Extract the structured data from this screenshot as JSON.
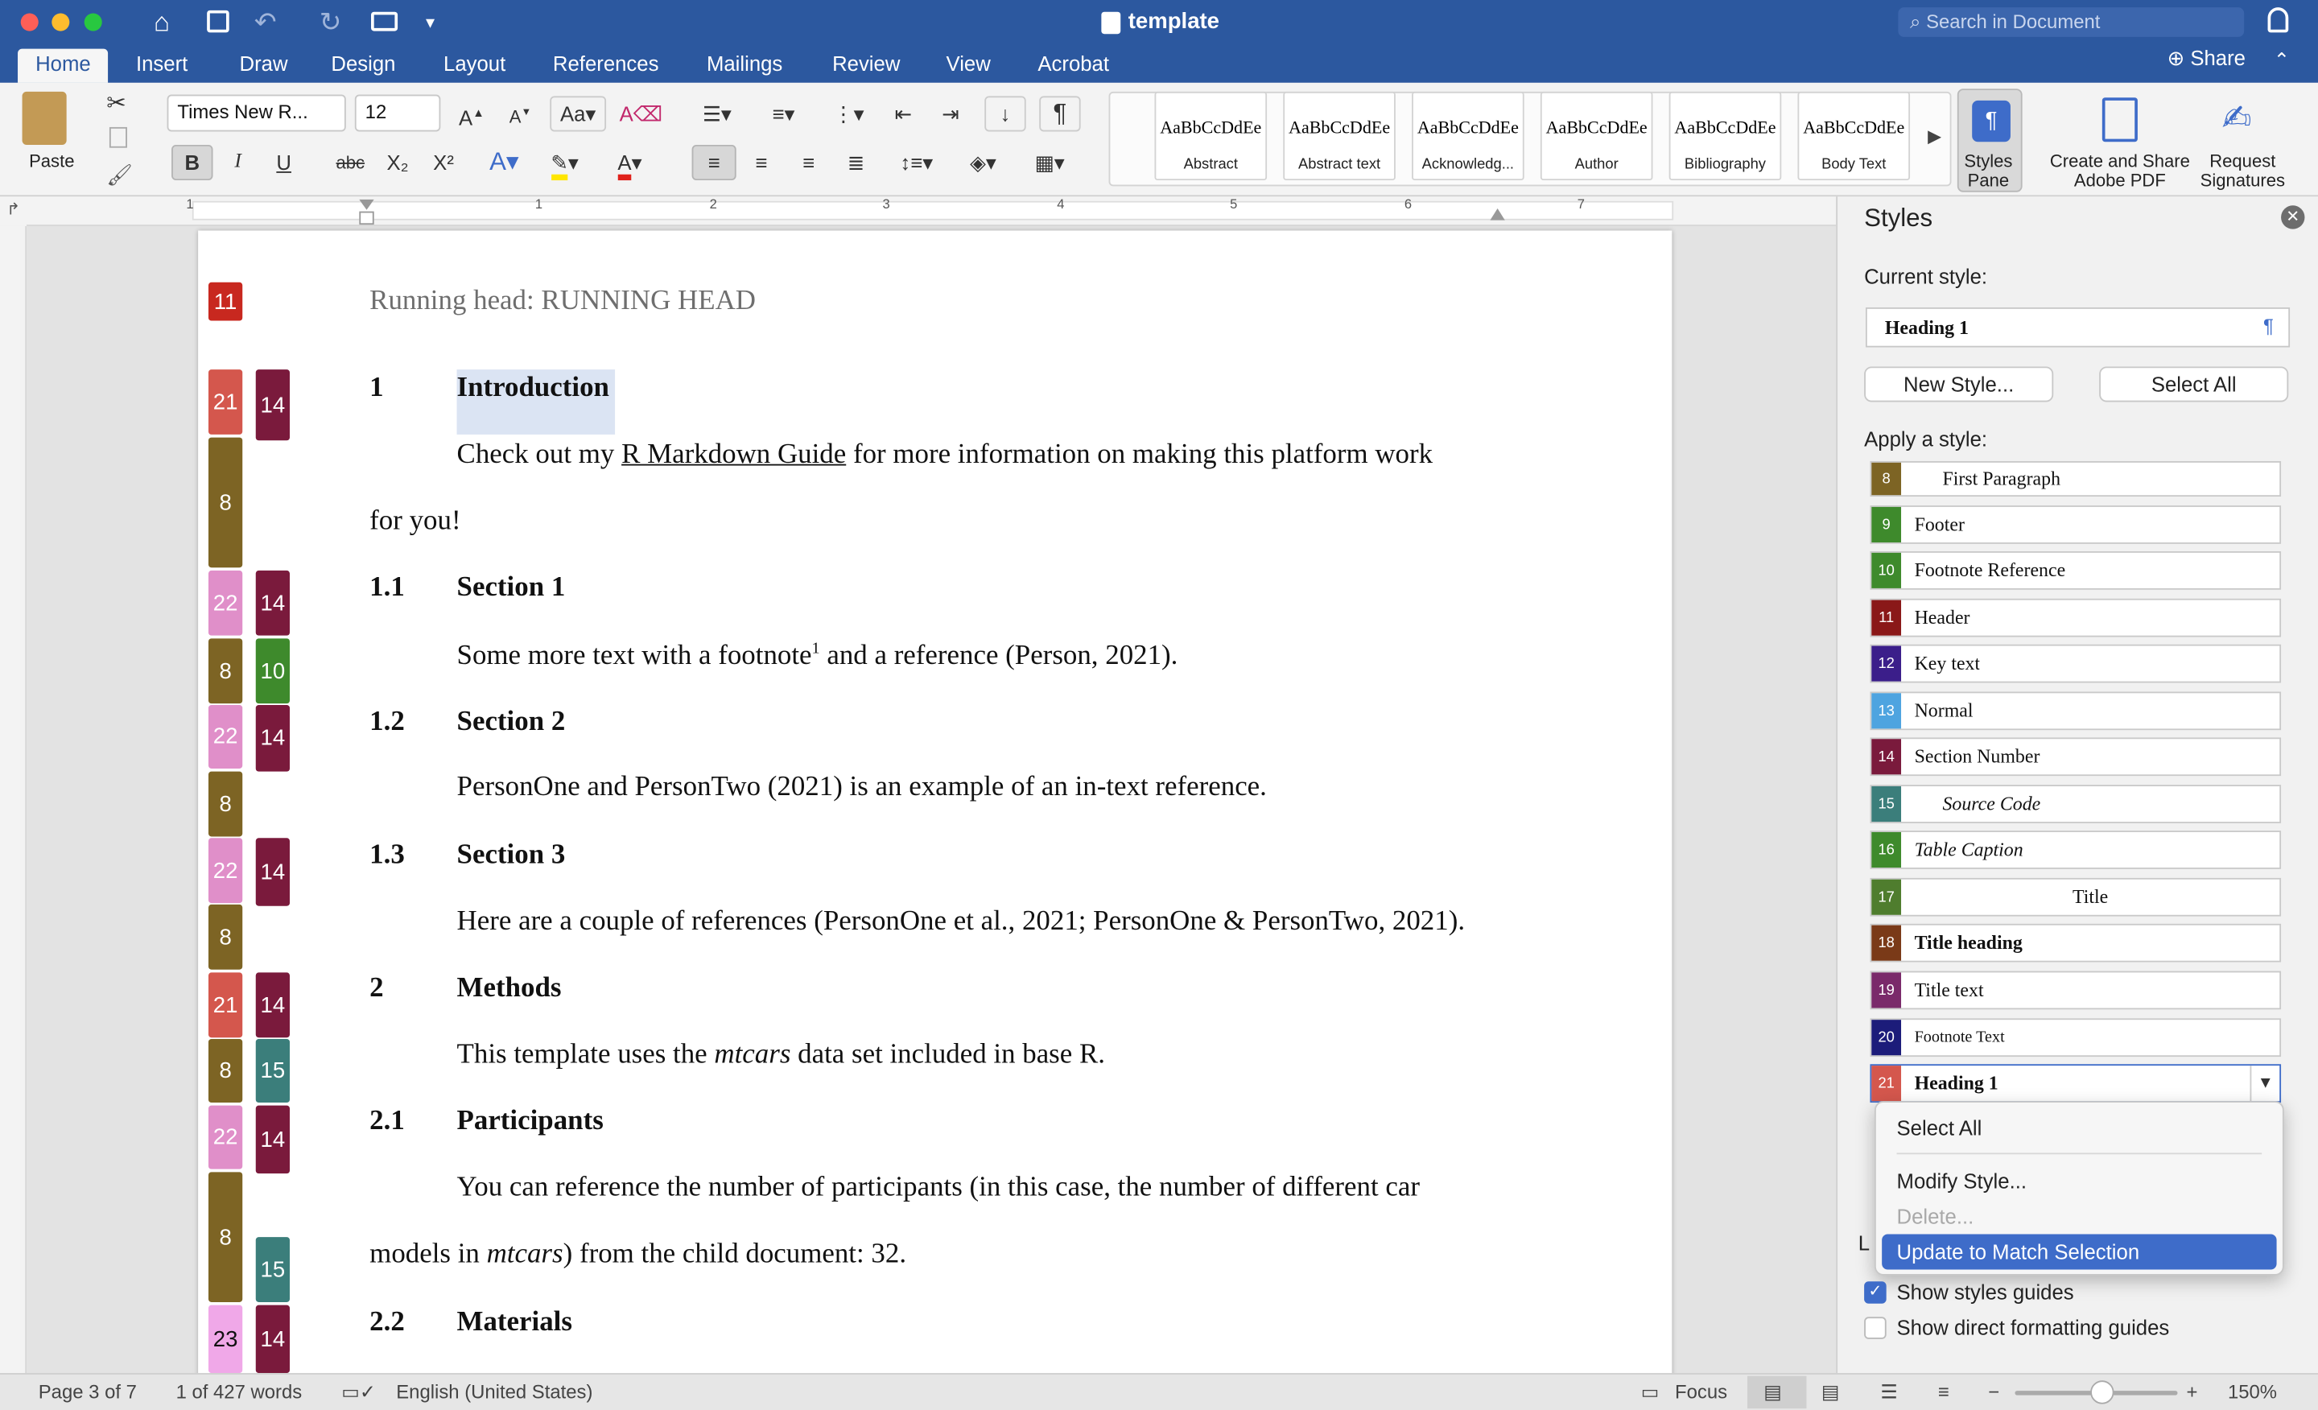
{
  "window": {
    "title": "template",
    "search_placeholder": "Search in Document"
  },
  "tabs": [
    "Home",
    "Insert",
    "Draw",
    "Design",
    "Layout",
    "References",
    "Mailings",
    "Review",
    "View",
    "Acrobat"
  ],
  "share_label": "Share",
  "ribbon": {
    "paste": "Paste",
    "font_name": "Times New R...",
    "font_size": "12",
    "bold": "B",
    "italic": "I",
    "underline": "U",
    "strike": "abc",
    "sub": "X₂",
    "sup": "X²",
    "gallery": [
      {
        "sample": "AaBbCcDdEe",
        "name": "Abstract"
      },
      {
        "sample": "AaBbCcDdEe",
        "name": "Abstract text"
      },
      {
        "sample": "AaBbCcDdEe",
        "name": "Acknowledg..."
      },
      {
        "sample": "AaBbCcDdEe",
        "name": "Author"
      },
      {
        "sample": "AaBbCcDdEe",
        "name": "Bibliography"
      },
      {
        "sample": "AaBbCcDdEe",
        "name": "Body Text"
      }
    ],
    "styles_pane": [
      "Styles",
      "Pane"
    ],
    "create_share": [
      "Create and Share",
      "Adobe PDF"
    ],
    "request_sig": [
      "Request",
      "Signatures"
    ]
  },
  "ruler_numbers": [
    "1",
    "1",
    "2",
    "3",
    "4",
    "5",
    "6",
    "7"
  ],
  "document": {
    "running_head": "Running head: RUNNING HEAD",
    "h1_num": "1",
    "h1": "Introduction",
    "p1a": "Check out my ",
    "p1link": "R Markdown Guide",
    "p1b": " for more information on making this platform work",
    "p1c": "for you!",
    "s11_num": "1.1",
    "s11": "Section 1",
    "p2a": "Some more text with a footnote",
    "p2sup": "1",
    "p2b": " and a reference (Person, 2021).",
    "s12_num": "1.2",
    "s12": "Section 2",
    "p3": "PersonOne and PersonTwo (2021) is an example of an in-text reference.",
    "s13_num": "1.3",
    "s13": "Section 3",
    "p4": "Here are a couple of references (PersonOne et al., 2021; PersonOne & PersonTwo, 2021).",
    "h2_num": "2",
    "h2": "Methods",
    "p5a": "This template uses the ",
    "p5i": "mtcars",
    "p5b": " data set included in base R.",
    "s21_num": "2.1",
    "s21": "Participants",
    "p6": "You can reference the number of participants (in this case, the number of different car",
    "p7a": "models in ",
    "p7i": "mtcars",
    "p7b": ") from the child document: 32.",
    "s22_num": "2.2",
    "s22": "Materials"
  },
  "guides": {
    "col1": [
      "11",
      "21",
      "8",
      "22",
      "8",
      "22",
      "8",
      "22",
      "8",
      "21",
      "8",
      "22",
      "8",
      "23"
    ],
    "col2": [
      "14",
      "14",
      "10",
      "14",
      "14",
      "14",
      "15",
      "14",
      "15",
      "14"
    ]
  },
  "styles_pane": {
    "title": "Styles",
    "current_label": "Current style:",
    "current_value": "Heading 1",
    "new_style": "New Style...",
    "select_all": "Select All",
    "apply_label": "Apply a style:",
    "list": [
      {
        "num": "8",
        "name": "First Paragraph"
      },
      {
        "num": "9",
        "name": "Footer"
      },
      {
        "num": "10",
        "name": "Footnote Reference"
      },
      {
        "num": "11",
        "name": "Header"
      },
      {
        "num": "12",
        "name": "Key text"
      },
      {
        "num": "13",
        "name": "Normal"
      },
      {
        "num": "14",
        "name": "Section Number"
      },
      {
        "num": "15",
        "name": "Source Code"
      },
      {
        "num": "16",
        "name": "Table Caption"
      },
      {
        "num": "17",
        "name": "Title"
      },
      {
        "num": "18",
        "name": "Title heading"
      },
      {
        "num": "19",
        "name": "Title text"
      },
      {
        "num": "20",
        "name": "Footnote Text"
      },
      {
        "num": "21",
        "name": "Heading 1"
      }
    ],
    "menu": [
      "Select All",
      "Modify Style...",
      "Delete...",
      "Update to Match Selection"
    ],
    "partial_label": "L",
    "show_guides": "Show styles guides",
    "show_direct": "Show direct formatting guides"
  },
  "status": {
    "page": "Page 3 of 7",
    "words": "1 of 427 words",
    "language": "English (United States)",
    "focus": "Focus",
    "zoom": "150%"
  },
  "colors": {
    "title_blue": "#2c589f",
    "select_blue": "#3e6cc9",
    "guide_21": "#d4574d",
    "guide_22": "#e08fc9",
    "guide_8": "#7d6424",
    "guide_14": "#7a1a3c",
    "guide_10": "#3e8a2c",
    "guide_15": "#3b7e7b",
    "guide_11": "#c8281f",
    "guide_23": "#f0a8e8"
  }
}
